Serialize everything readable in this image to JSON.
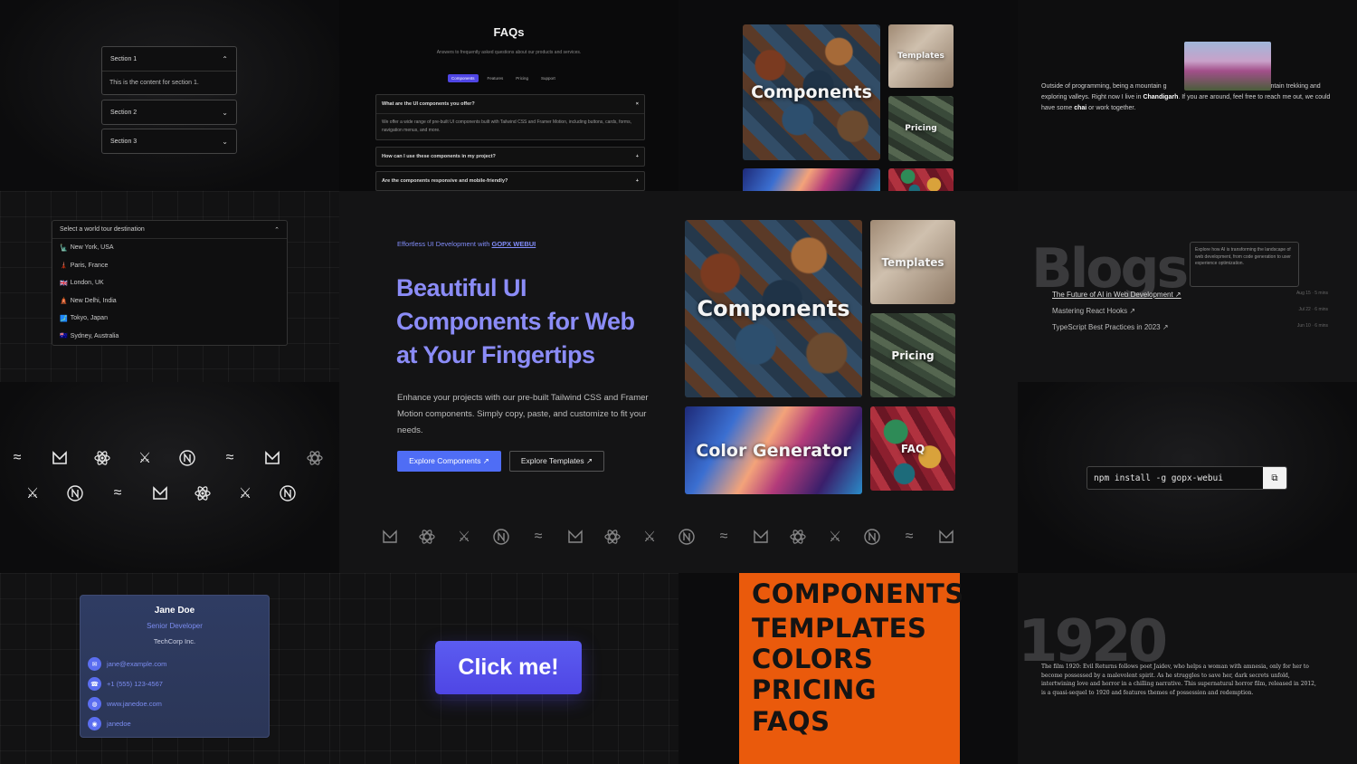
{
  "accordion": {
    "sections": [
      {
        "label": "Section 1",
        "content": "This is the content for section 1."
      },
      {
        "label": "Section 2"
      },
      {
        "label": "Section 3"
      }
    ]
  },
  "destination": {
    "placeholder": "Select a world tour destination",
    "options": [
      {
        "flag": "🗽",
        "label": "New York, USA"
      },
      {
        "flag": "🗼",
        "label": "Paris, France"
      },
      {
        "flag": "🇬🇧",
        "label": "London, UK"
      },
      {
        "flag": "🛕",
        "label": "New Delhi, India"
      },
      {
        "flag": "🗾",
        "label": "Tokyo, Japan"
      },
      {
        "flag": "🇦🇺",
        "label": "Sydney, Australia"
      }
    ]
  },
  "faq": {
    "title": "FAQs",
    "subtitle": "Answers to frequently asked questions about our products and services.",
    "tabs": [
      "Components",
      "Features",
      "Pricing",
      "Support"
    ],
    "active_tab": "Components",
    "questions": [
      {
        "q": "What are the UI components you offer?",
        "a": "We offer a wide range of pre-built UI components built with Tailwind CSS and Framer Motion, including buttons, cards, forms, navigation menus, and more.",
        "open": true
      },
      {
        "q": "How can I use these components in my project?",
        "open": false
      },
      {
        "q": "Are the components responsive and mobile-friendly?",
        "open": false
      }
    ]
  },
  "hero": {
    "eyebrow_prefix": "Effortless UI Development with",
    "eyebrow_brand": "GOPX WEBUI",
    "title_line1": "Beautiful UI",
    "title_line2": "Components for Web",
    "title_line3": "at Your Fingertips",
    "description": "Enhance your projects with our pre-built Tailwind CSS and Framer Motion components. Simply copy, paste, and customize to fit your needs.",
    "primary_button": "Explore Components ↗",
    "secondary_button": "Explore Templates ↗"
  },
  "tiles": {
    "components": "Components",
    "templates": "Templates",
    "pricing": "Pricing",
    "color_generator": "Color Generator",
    "faq": "FAQ"
  },
  "about": {
    "text_1": "Outside of programming, being a mountain g",
    "text_2": "uy mountain trekking and exploring valleys. Right now I live in",
    "city": "Chandigarh",
    "text_3": ". If you are around, feel free to reach me out, we could have some",
    "chai": "chai",
    "text_4": "or work together."
  },
  "blogs": {
    "heading": "Blogs",
    "tooltip": "Explore how AI is transforming the landscape of web development, from code generation to user experience optimization.",
    "posts": [
      {
        "title": "The Future of AI in Web Development ↗",
        "meta": "Aug 15 · 5 mins"
      },
      {
        "title": "Mastering React Hooks ↗",
        "meta": "Jul 22 · 6 mins"
      },
      {
        "title": "TypeScript Best Practices in 2023 ↗",
        "meta": "Jun 10 · 6 mins"
      }
    ]
  },
  "npm": {
    "command": "npm install -g gopx-webui",
    "copy_icon": "copy-icon"
  },
  "profile": {
    "name": "Jane Doe",
    "role": "Senior Developer",
    "company": "TechCorp Inc.",
    "email": "jane@example.com",
    "phone": "+1 (555) 123-4567",
    "website": "www.janedoe.com",
    "handle": "janedoe"
  },
  "click_button": "Click me!",
  "marquee": {
    "partial": "COMPONENTS",
    "lines": [
      "TEMPLATES",
      "COLORS",
      "PRICING",
      "FAQS"
    ],
    "accent": "#ea5a0c"
  },
  "film": {
    "year": "1920",
    "text": "The film 1920: Evil Returns follows poet Jaidev, who helps a woman with amnesia, only for her to become possessed by a malevolent spirit. As he struggles to save her, dark secrets unfold, intertwining love and horror in a chilling narrative. This supernatural horror film, released in 2012, is a quasi-sequel to 1920 and features themes of possession and redemption."
  },
  "icons": [
    "tailwind-icon",
    "framer-icon",
    "react-icon",
    "character-icon",
    "nextjs-icon"
  ],
  "colors": {
    "accent": "#4f6df5",
    "hero_title": "#8b8cf7",
    "card_bg": "#2f3c63"
  }
}
